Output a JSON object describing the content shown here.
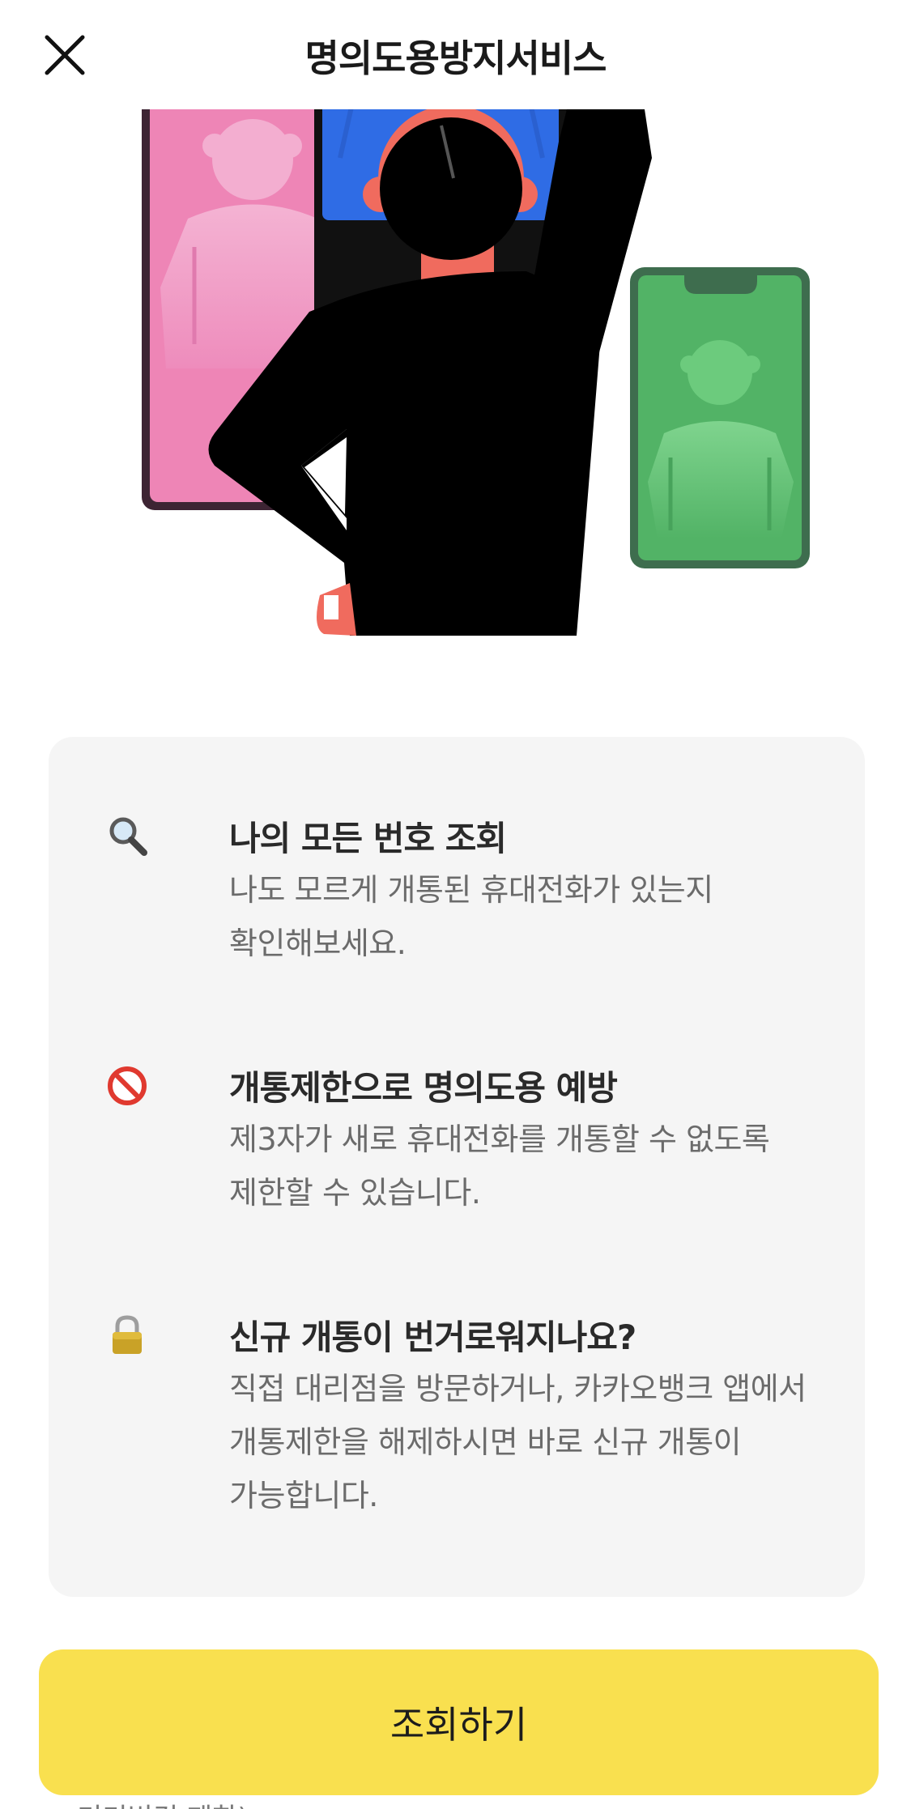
{
  "header": {
    "title": "명의도용방지서비스",
    "close_icon": "close-icon"
  },
  "illustration": {
    "name": "person-viewing-phones-illustration",
    "colors": {
      "pink": "#ee85b6",
      "blue": "#2f6ce5",
      "green": "#52b366",
      "skin": "#f06b5e",
      "black": "#000000"
    }
  },
  "features": [
    {
      "icon": "magnifier-icon",
      "title": "나의 모든 번호 조회",
      "description": "나도 모르게 개통된 휴대전화가 있는지\n확인해보세요."
    },
    {
      "icon": "prohibited-icon",
      "title": "개통제한으로 명의도용 예방",
      "description": "제3자가 새로 휴대전화를 개통할 수 없도록\n제한할 수 있습니다."
    },
    {
      "icon": "lock-icon",
      "title": "신규 개통이 번거로워지나요?",
      "description": "직접 대리점을 방문하거나, 카카오뱅크 앱에서\n개통제한을 해제하시면 바로 신규 개통이\n가능합니다."
    }
  ],
  "cta": {
    "label": "조회하기",
    "color": "#f9e04f"
  },
  "footnote": "기기변경 제한)"
}
